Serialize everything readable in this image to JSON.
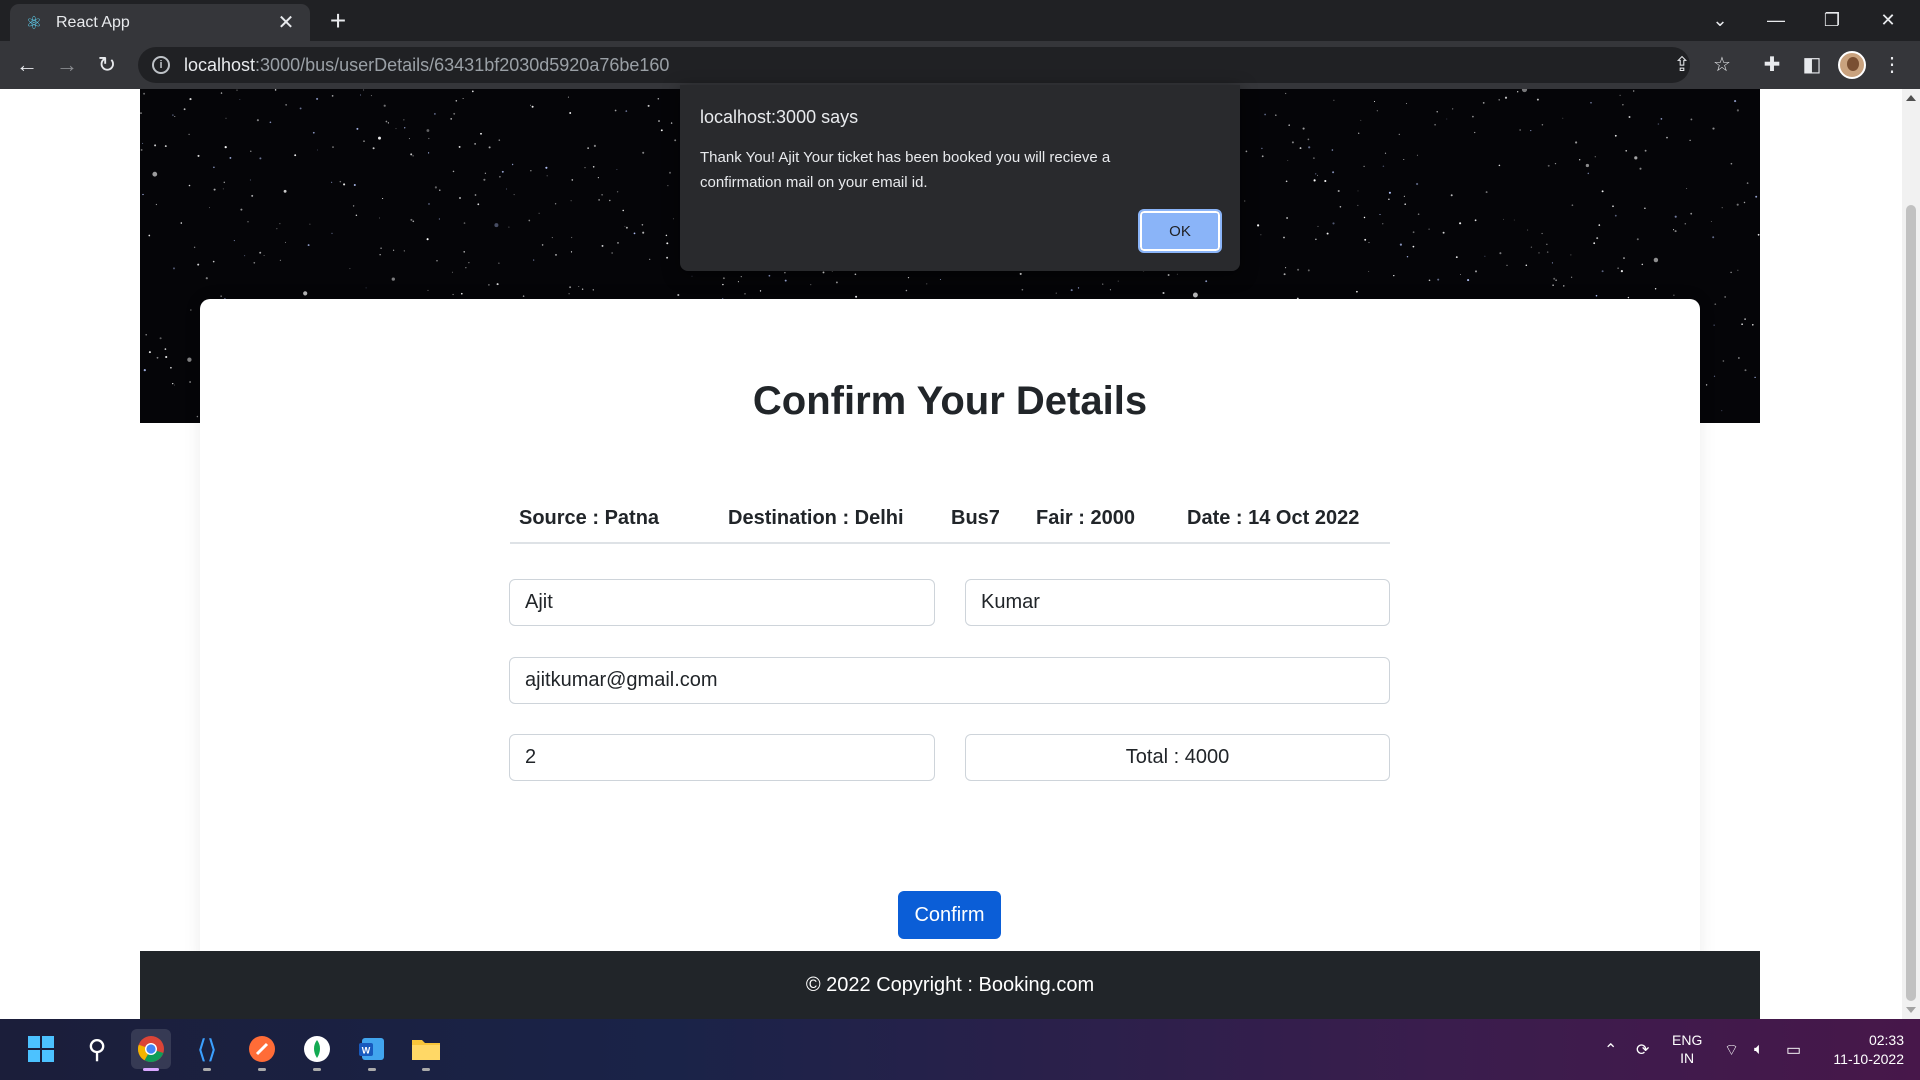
{
  "browser": {
    "tab_title": "React App",
    "tab_close": "✕",
    "new_tab": "+",
    "url_host": "localhost",
    "url_path": ":3000/bus/userDetails/63431bf2030d5920a76be160"
  },
  "dialog": {
    "title": "localhost:3000 says",
    "message": "Thank You! Ajit Your ticket has been booked you will recieve a confirmation mail on your email id.",
    "ok_label": "OK"
  },
  "page": {
    "heading": "Confirm Your Details",
    "trip": {
      "source": "Source : Patna",
      "destination": "Destination : Delhi",
      "bus": "Bus7",
      "fair": "Fair : 2000",
      "date": "Date : 14 Oct 2022"
    },
    "form": {
      "first_name": "Ajit",
      "last_name": "Kumar",
      "email": "ajitkumar@gmail.com",
      "seats": "2",
      "total": "Total : 4000"
    },
    "confirm_label": "Confirm",
    "footer": "© 2022 Copyright : Booking.com"
  },
  "taskbar": {
    "lang_top": "ENG",
    "lang_bottom": "IN",
    "time": "02:33",
    "date": "11-10-2022"
  },
  "colors": {
    "primary_button": "#0b5ed7",
    "footer_bg": "#212529",
    "dialog_bg": "#292a2d",
    "dialog_ok": "#8ab4f8"
  }
}
